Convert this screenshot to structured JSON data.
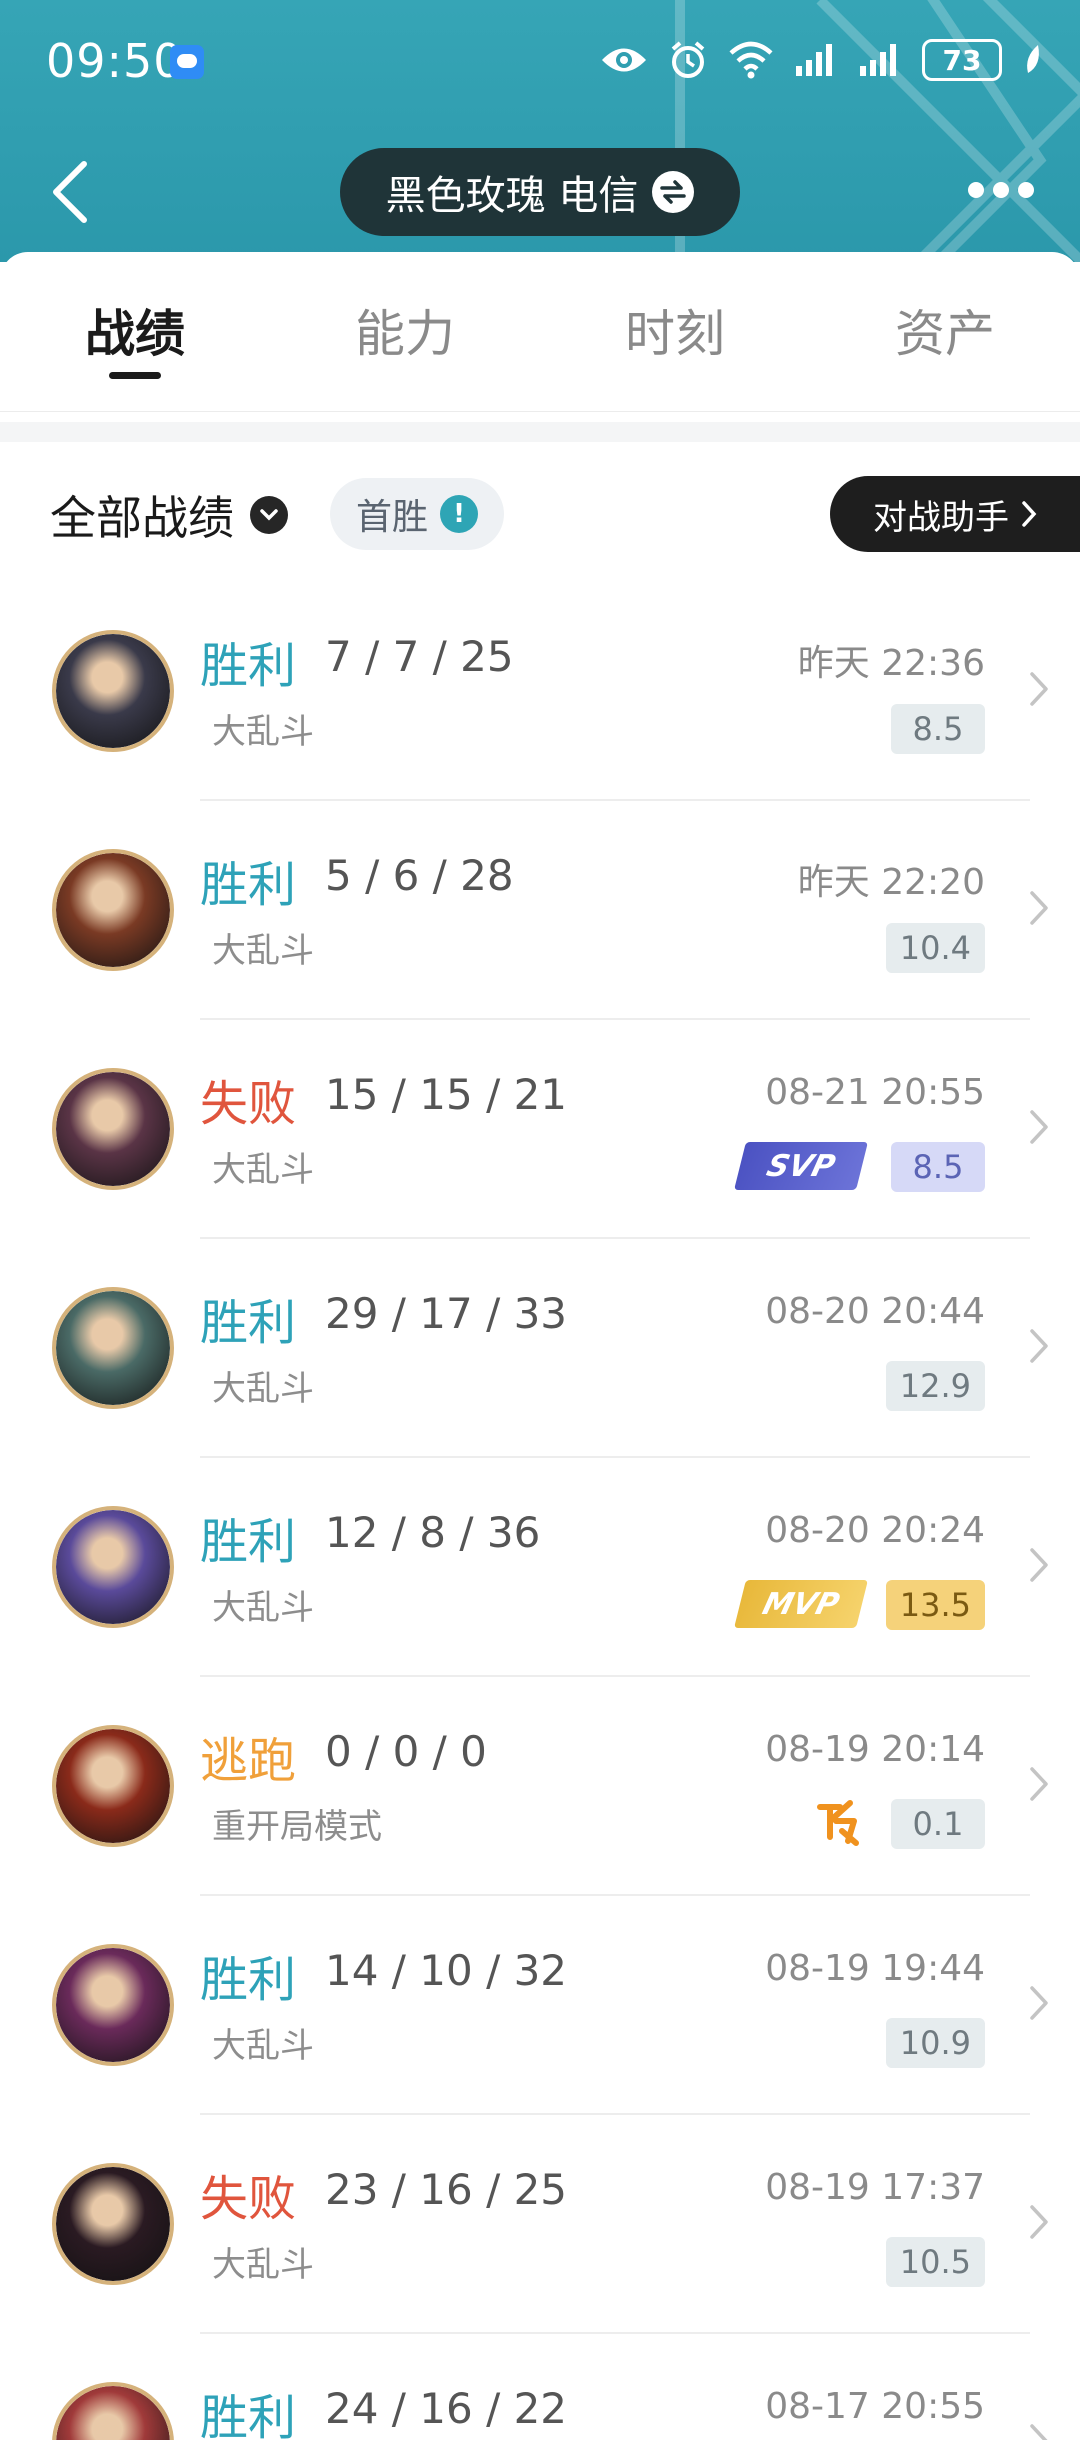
{
  "status_bar": {
    "time": "09:50",
    "battery": "73"
  },
  "header": {
    "account_name": "黑色玫瑰 电信"
  },
  "tabs": [
    {
      "label": "战绩",
      "active": true
    },
    {
      "label": "能力",
      "active": false
    },
    {
      "label": "时刻",
      "active": false
    },
    {
      "label": "资产",
      "active": false
    }
  ],
  "filter": {
    "label": "全部战绩",
    "first_win": "首胜",
    "first_win_info": "!",
    "assistant": "对战助手"
  },
  "matches": [
    {
      "result": "胜利",
      "result_type": "win",
      "kda": "7 / 7 / 25",
      "mode": "大乱斗",
      "time": "昨天 22:36",
      "score": "8.5",
      "badge": "",
      "avatar_color": "#3a3a4a"
    },
    {
      "result": "胜利",
      "result_type": "win",
      "kda": "5 / 6 / 28",
      "mode": "大乱斗",
      "time": "昨天 22:20",
      "score": "10.4",
      "badge": "",
      "avatar_color": "#7a3a24"
    },
    {
      "result": "失败",
      "result_type": "lose",
      "kda": "15 / 15 / 21",
      "mode": "大乱斗",
      "time": "08-21 20:55",
      "score": "8.5",
      "badge": "svp",
      "avatar_color": "#5a3446"
    },
    {
      "result": "胜利",
      "result_type": "win",
      "kda": "29 / 17 / 33",
      "mode": "大乱斗",
      "time": "08-20 20:44",
      "score": "12.9",
      "badge": "",
      "avatar_color": "#4a6a66"
    },
    {
      "result": "胜利",
      "result_type": "win",
      "kda": "12 / 8 / 36",
      "mode": "大乱斗",
      "time": "08-20 20:24",
      "score": "13.5",
      "badge": "mvp",
      "avatar_color": "#5a4a9a"
    },
    {
      "result": "逃跑",
      "result_type": "escape",
      "kda": "0 / 0 / 0",
      "mode": "重开局模式",
      "time": "08-19 20:14",
      "score": "0.1",
      "badge": "escape",
      "avatar_color": "#8a2a1a"
    },
    {
      "result": "胜利",
      "result_type": "win",
      "kda": "14 / 10 / 32",
      "mode": "大乱斗",
      "time": "08-19 19:44",
      "score": "10.9",
      "badge": "",
      "avatar_color": "#6a2a5a"
    },
    {
      "result": "失败",
      "result_type": "lose",
      "kda": "23 / 16 / 25",
      "mode": "大乱斗",
      "time": "08-19 17:37",
      "score": "10.5",
      "badge": "",
      "avatar_color": "#2a1a22"
    },
    {
      "result": "胜利",
      "result_type": "win",
      "kda": "24 / 16 / 22",
      "mode": "",
      "time": "08-17 20:55",
      "score": "",
      "badge": "",
      "avatar_color": "#a03a3a"
    }
  ],
  "badges": {
    "svp": "SVP",
    "mvp": "MVP"
  },
  "icons": {
    "back": "back-arrow-icon",
    "switch": "swap-arrows-icon",
    "more": "more-dots-icon",
    "info": "info-icon",
    "dropdown": "chevron-down-icon",
    "row": "chevron-right-icon",
    "escape": "escape-icon"
  },
  "colors": {
    "accent": "#2ea2b8",
    "lose": "#e0553d",
    "escape": "#f0a03a",
    "header_bg": "#33a1b3"
  }
}
